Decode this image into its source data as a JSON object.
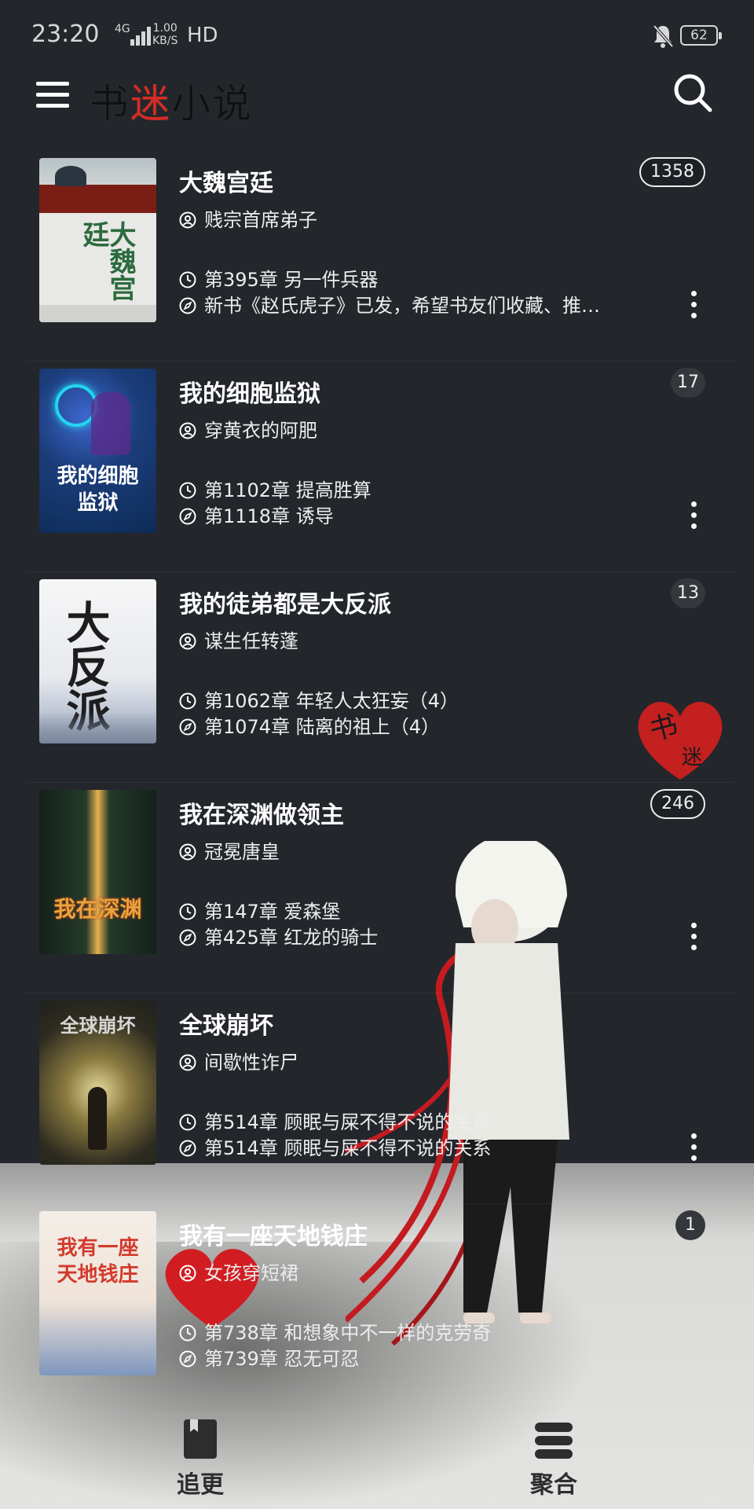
{
  "status_bar": {
    "time": "23:20",
    "network": "4G",
    "speed_value": "1.00",
    "speed_unit": "KB/S",
    "hd": "HD",
    "battery": "62"
  },
  "app": {
    "logo": "书迷小说",
    "menu_icon": "hamburger-menu-icon",
    "search_icon": "search-icon"
  },
  "books": [
    {
      "title": "大魏宫廷",
      "author": "贱宗首席弟子",
      "latest_chapter": "第395章 另一件兵器",
      "last_read": "新书《赵氏虎子》已发，希望书友们收藏、推…",
      "badge": "1358",
      "cover_title": "大魏宫廷",
      "cover_colors": [
        "#e8e8e6",
        "#7a1d14",
        "#2c6b3e"
      ]
    },
    {
      "title": "我的细胞监狱",
      "author": "穿黄衣的阿肥",
      "latest_chapter": "第1102章 提高胜算",
      "last_read": "第1118章 诱导",
      "badge": "17",
      "cover_title": "我的细胞监狱",
      "cover_colors": [
        "#0e2b57",
        "#3d68d1",
        "#22d6f0"
      ]
    },
    {
      "title": "我的徒弟都是大反派",
      "author": "谋生任转蓬",
      "latest_chapter": "第1062章 年轻人太狂妄（4）",
      "last_read": "第1074章 陆离的祖上（4）",
      "badge": "13",
      "cover_title": "大反派",
      "cover_colors": [
        "#f2f2f2",
        "#9aa7bd",
        "#1d1d1d"
      ]
    },
    {
      "title": "我在深渊做领主",
      "author": "冠冕唐皇",
      "latest_chapter": "第147章 爱森堡",
      "last_read": "第425章 红龙的骑士",
      "badge": "246",
      "cover_title": "我在深渊",
      "cover_colors": [
        "#1b2a20",
        "#e9b04d",
        "#c23b1a"
      ]
    },
    {
      "title": "全球崩坏",
      "author": "间歇性诈尸",
      "latest_chapter": "第514章 顾眠与屎不得不说的关系",
      "last_read": "第514章 顾眠与屎不得不说的关系",
      "badge": "",
      "cover_title": "全球崩坏",
      "cover_colors": [
        "#1f211d",
        "#d8c27a",
        "#5a4a2a"
      ]
    },
    {
      "title": "我有一座天地钱庄",
      "author": "女孩穿短裙",
      "latest_chapter": "第738章 和想象中不一样的克劳奇",
      "last_read": "第739章 忍无可忍",
      "badge": "1",
      "cover_title": "我有一座天地钱庄",
      "cover_colors": [
        "#f4eee8",
        "#d33a2c",
        "#5d7fb2"
      ]
    }
  ],
  "bottom_nav": [
    {
      "label": "追更",
      "icon": "bookmark-book-icon"
    },
    {
      "label": "聚合",
      "icon": "stack-layers-icon"
    }
  ]
}
